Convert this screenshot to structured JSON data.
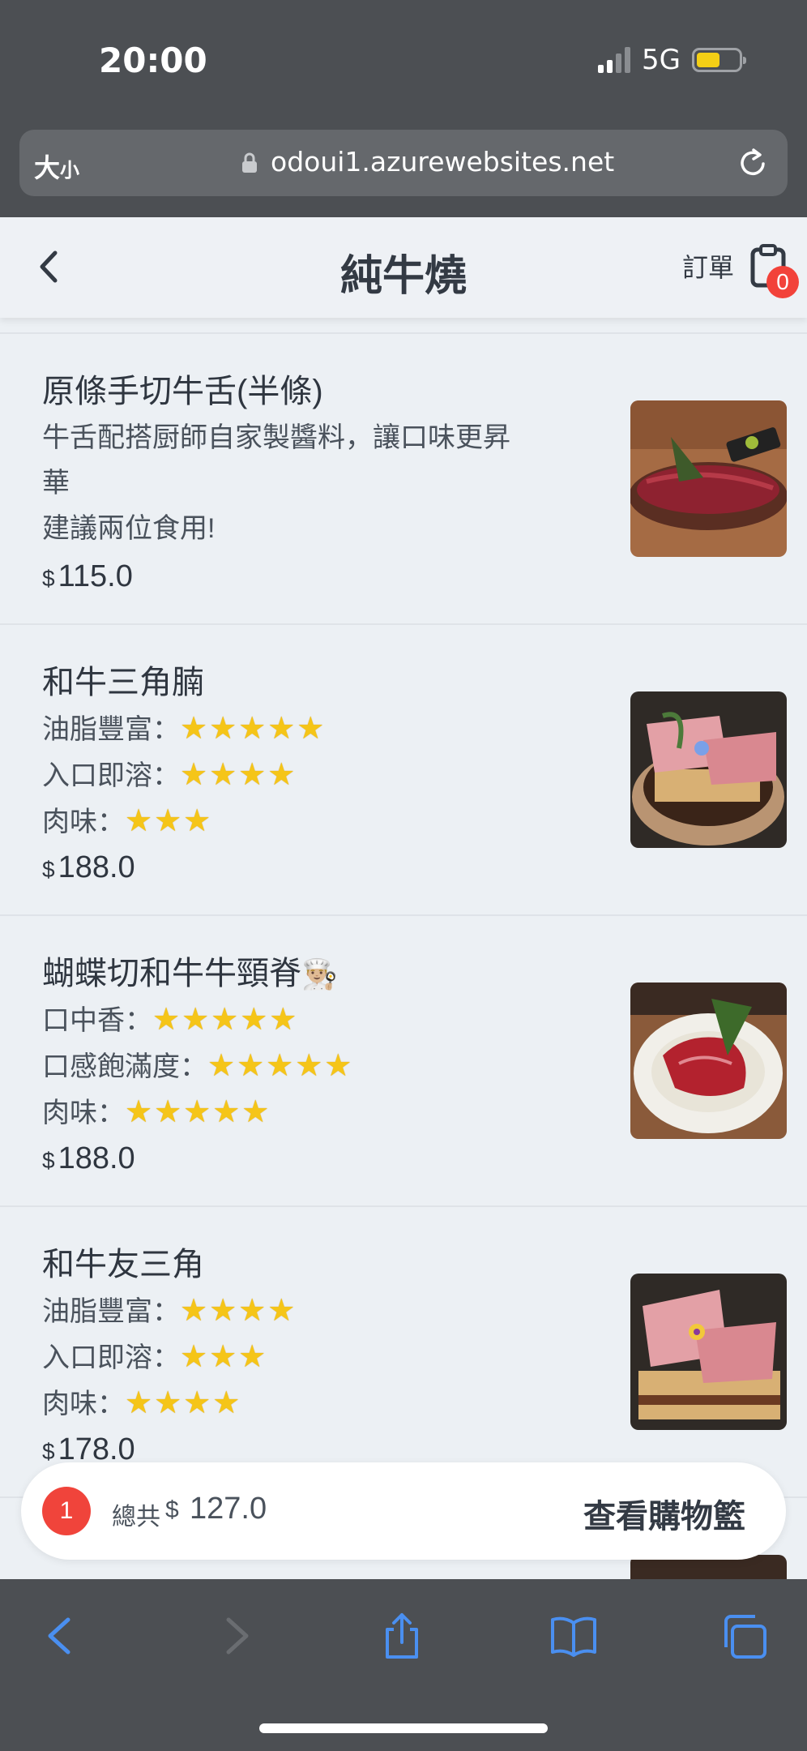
{
  "status": {
    "time": "20:00",
    "network": "5G"
  },
  "browser": {
    "text_size": "大",
    "text_size_small": "小",
    "url": "odoui1.azurewebsites.net"
  },
  "header": {
    "title": "純牛燒",
    "orders_label": "訂單",
    "cart_badge": "0"
  },
  "menu": [
    {
      "name": "原條手切牛舌(半條)",
      "desc_lines": [
        "牛舌配搭厨師自家製醬料，讓口味更昇",
        "華",
        "建議兩位食用!"
      ],
      "currency": "$",
      "price": "115.0"
    },
    {
      "name": "和牛三角腩",
      "ratings": [
        {
          "label": "油脂豐富：",
          "stars": "★★★★★"
        },
        {
          "label": "入口即溶：",
          "stars": "★★★★"
        },
        {
          "label": "肉味：",
          "stars": "★★★"
        }
      ],
      "currency": "$",
      "price": "188.0"
    },
    {
      "name": "蝴蝶切和牛牛頸脊",
      "emoji": "👨🏼‍🍳",
      "ratings": [
        {
          "label": "口中香：",
          "stars": "★★★★★"
        },
        {
          "label": "口感飽滿度：",
          "stars": "★★★★★"
        },
        {
          "label": "肉味：",
          "stars": "★★★★★"
        }
      ],
      "currency": "$",
      "price": "188.0"
    },
    {
      "name": "和牛友三角",
      "ratings": [
        {
          "label": "油脂豐富：",
          "stars": "★★★★"
        },
        {
          "label": "入口即溶：",
          "stars": "★★★"
        },
        {
          "label": "肉味：",
          "stars": "★★★★"
        }
      ],
      "currency": "$",
      "price": "178.0"
    }
  ],
  "cart": {
    "count": "1",
    "total_label": "總共",
    "currency": "$",
    "total": "127.0",
    "view_label": "查看購物籃"
  },
  "colors": {
    "accent_red": "#f0443b",
    "star": "#f5c518",
    "chrome": "#4c4f53",
    "safari_blue": "#4a8ff0"
  }
}
